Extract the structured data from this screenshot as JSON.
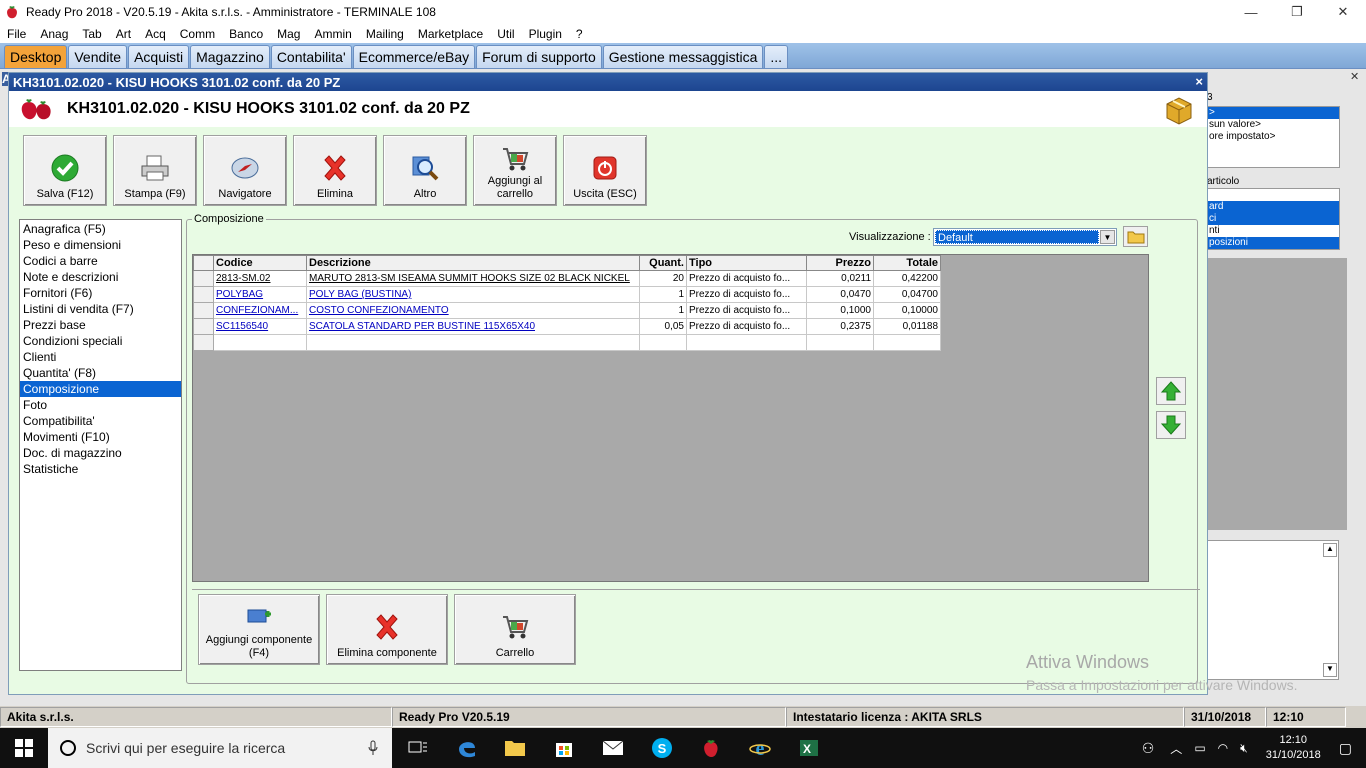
{
  "window": {
    "title": "Ready Pro 2018 - V20.5.19 - Akita s.r.l.s. - Amministratore - TERMINALE 108",
    "minimize": "—",
    "restore": "❐",
    "close": "✕"
  },
  "menu": [
    "File",
    "Anag",
    "Tab",
    "Art",
    "Acq",
    "Comm",
    "Banco",
    "Mag",
    "Ammin",
    "Mailing",
    "Marketplace",
    "Util",
    "Plugin",
    "?"
  ],
  "tabs": [
    {
      "label": "Desktop",
      "active": true
    },
    {
      "label": "Vendite",
      "active": false
    },
    {
      "label": "Acquisti",
      "active": false
    },
    {
      "label": "Magazzino",
      "active": false
    },
    {
      "label": "Contabilita'",
      "active": false
    },
    {
      "label": "Ecommerce/eBay",
      "active": false
    },
    {
      "label": "Forum di supporto",
      "active": false
    },
    {
      "label": "Gestione messaggistica",
      "active": false
    },
    {
      "label": "...",
      "active": false
    }
  ],
  "background": {
    "left_letter": "A",
    "panel1_digit": "3",
    "panel1_items": [
      ">",
      "sun valore>",
      "ore impostato>"
    ],
    "panel2_title": "articolo",
    "panel2_items": [
      "ard",
      "ci",
      "nti",
      "posizioni"
    ]
  },
  "mdi": {
    "title": "KH3101.02.020 - KISU HOOKS 3101.02 conf. da 20 PZ",
    "header": "KH3101.02.020 - KISU HOOKS 3101.02 conf. da 20 PZ",
    "close": "×"
  },
  "toolbar": [
    {
      "label": "Salva (F12)",
      "icon": "check-icon"
    },
    {
      "label": "Stampa (F9)",
      "icon": "printer-icon"
    },
    {
      "label": "Navigatore",
      "icon": "compass-icon"
    },
    {
      "label": "Elimina",
      "icon": "delete-x-icon"
    },
    {
      "label": "Altro",
      "icon": "magnifier-icon"
    },
    {
      "label": "Aggiungi al carrello",
      "icon": "cart-add-icon"
    },
    {
      "label": "Uscita (ESC)",
      "icon": "power-icon"
    }
  ],
  "nav": [
    "Anagrafica (F5)",
    "Peso e dimensioni",
    "Codici a barre",
    "Note e descrizioni",
    "Fornitori (F6)",
    "Listini di vendita (F7)",
    "Prezzi base",
    "Condizioni speciali",
    "Clienti",
    "Quantita' (F8)",
    "Composizione",
    "Foto",
    "Compatibilita'",
    "Movimenti (F10)",
    "Doc. di magazzino",
    "Statistiche"
  ],
  "nav_selected": "Composizione",
  "composizione": {
    "group_label": "Composizione",
    "viz_label": "Visualizzazione :",
    "viz_value": "Default",
    "columns": [
      "Codice",
      "Descrizione",
      "Quant.",
      "Tipo",
      "Prezzo",
      "Totale"
    ],
    "rows": [
      {
        "codice": "2813-SM.02",
        "descrizione": "MARUTO 2813-SM ISEAMA SUMMIT HOOKS SIZE 02 BLACK NICKEL",
        "quant": "20",
        "tipo": "Prezzo di acquisto fo...",
        "prezzo": "0,0211",
        "totale": "0,42200"
      },
      {
        "codice": "POLYBAG",
        "descrizione": "POLY BAG (BUSTINA)",
        "quant": "1",
        "tipo": "Prezzo di acquisto fo...",
        "prezzo": "0,0470",
        "totale": "0,04700"
      },
      {
        "codice": "CONFEZIONAM...",
        "descrizione": "COSTO CONFEZIONAMENTO",
        "quant": "1",
        "tipo": "Prezzo di acquisto fo...",
        "prezzo": "0,1000",
        "totale": "0,10000"
      },
      {
        "codice": "SC1156540",
        "descrizione": "SCATOLA STANDARD PER BUSTINE 115X65X40",
        "quant": "0,05",
        "tipo": "Prezzo di acquisto fo...",
        "prezzo": "0,2375",
        "totale": "0,01188"
      }
    ]
  },
  "bottom_buttons": [
    {
      "label": "Aggiungi componente (F4)",
      "icon": "add-component-icon"
    },
    {
      "label": "Elimina componente",
      "icon": "delete-x-icon"
    },
    {
      "label": "Carrello",
      "icon": "cart-icon"
    }
  ],
  "watermark": {
    "line1": "Attiva Windows",
    "line2": "Passa a Impostazioni per attivare Windows."
  },
  "statusbar": {
    "company": "Akita s.r.l.s.",
    "version": "Ready Pro V20.5.19",
    "license": "Intestatario licenza : AKITA SRLS",
    "date": "31/10/2018",
    "time": "12:10"
  },
  "taskbar": {
    "search_placeholder": "Scrivi qui per eseguire la ricerca",
    "clock_time": "12:10",
    "clock_date": "31/10/2018"
  },
  "colors": {
    "accent_tab": "#f3a33a",
    "selection": "#0a64d2",
    "mdi_bg": "#e8fbe4",
    "title_blue": "#1d4590"
  }
}
